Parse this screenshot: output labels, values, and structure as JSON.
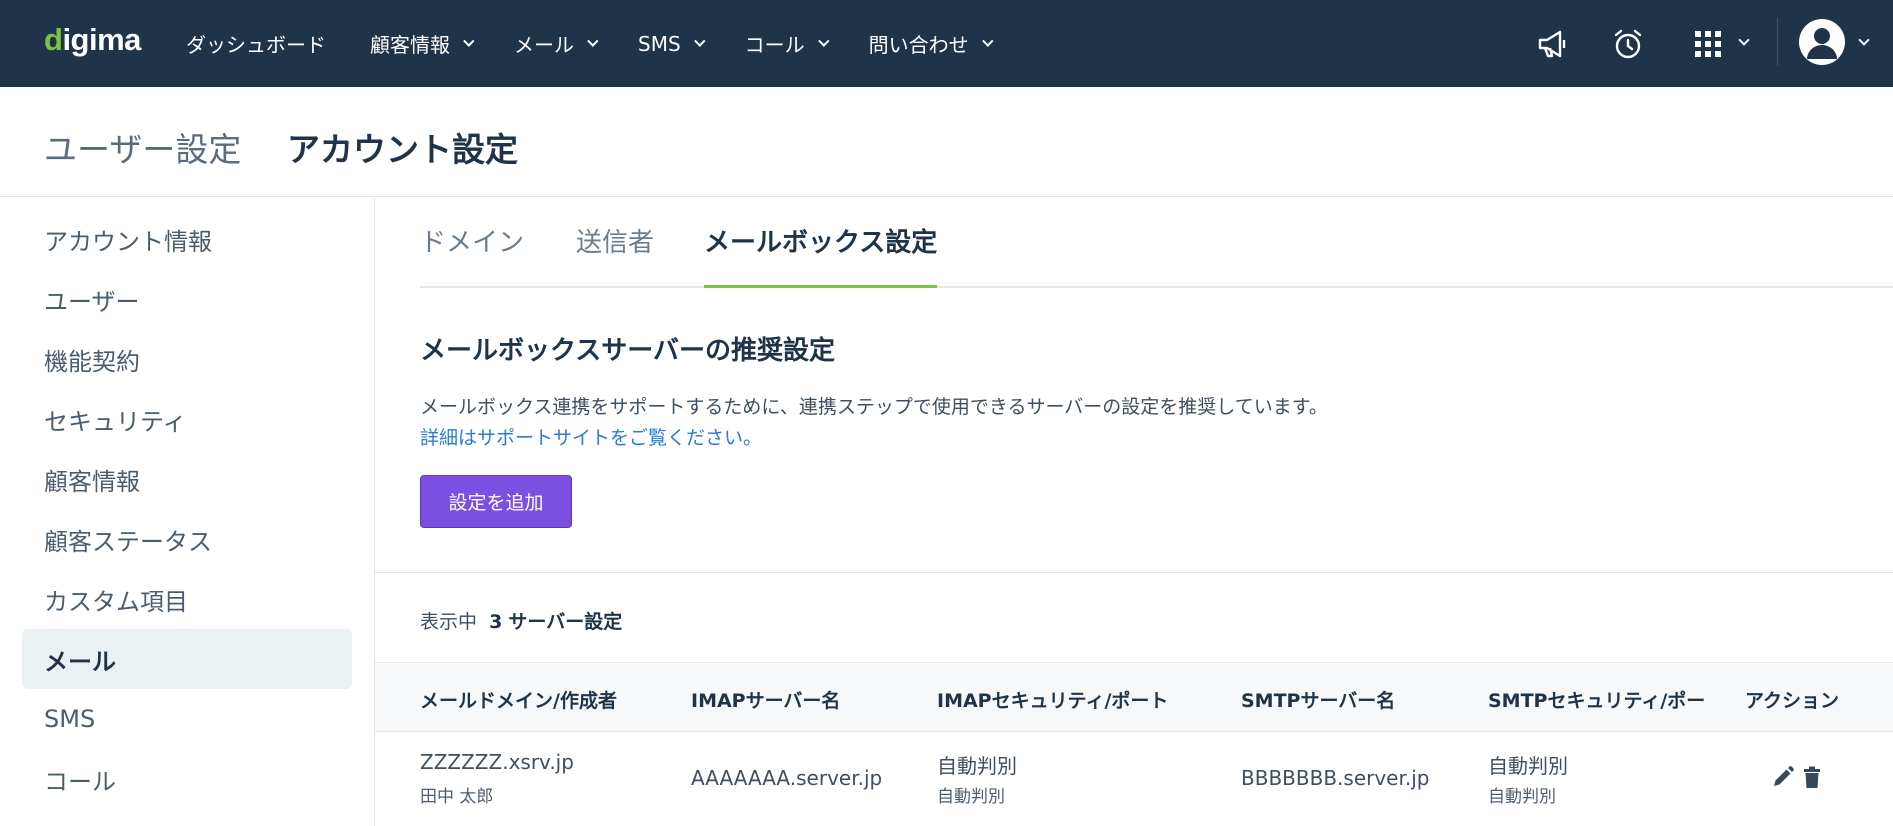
{
  "app": {
    "logo_pre": "d",
    "logo_rest": "igima"
  },
  "nav": {
    "items": [
      {
        "label": "ダッシュボード",
        "has_menu": false
      },
      {
        "label": "顧客情報",
        "has_menu": true
      },
      {
        "label": "メール",
        "has_menu": true
      },
      {
        "label": "SMS",
        "has_menu": true
      },
      {
        "label": "コール",
        "has_menu": true
      },
      {
        "label": "問い合わせ",
        "has_menu": true
      }
    ],
    "right_icons": [
      "megaphone-icon",
      "alarm-clock-icon",
      "apps-grid-icon",
      "user-avatar-icon"
    ]
  },
  "header": {
    "breadcrumb": "ユーザー設定",
    "title": "アカウント設定"
  },
  "sidebar": {
    "items": [
      {
        "label": "アカウント情報",
        "active": false
      },
      {
        "label": "ユーザー",
        "active": false
      },
      {
        "label": "機能契約",
        "active": false
      },
      {
        "label": "セキュリティ",
        "active": false
      },
      {
        "label": "顧客情報",
        "active": false
      },
      {
        "label": "顧客ステータス",
        "active": false
      },
      {
        "label": "カスタム項目",
        "active": false
      },
      {
        "label": "メール",
        "active": true
      },
      {
        "label": "SMS",
        "active": false
      },
      {
        "label": "コール",
        "active": false
      }
    ]
  },
  "tabs": [
    {
      "label": "ドメイン",
      "active": false
    },
    {
      "label": "送信者",
      "active": false
    },
    {
      "label": "メールボックス設定",
      "active": true
    }
  ],
  "section": {
    "title": "メールボックスサーバーの推奨設定",
    "description": "メールボックス連携をサポートするために、連携ステップで使用できるサーバーの設定を推奨しています。",
    "link": "詳細はサポートサイトをご覧ください。",
    "add_button": "設定を追加"
  },
  "count": {
    "prefix": "表示中",
    "value": "3",
    "suffix": "サーバー設定"
  },
  "table": {
    "columns": [
      "メールドメイン/作成者",
      "IMAPサーバー名",
      "IMAPセキュリティ/ポート",
      "SMTPサーバー名",
      "SMTPセキュリティ/ポー",
      "アクション"
    ],
    "rows": [
      {
        "domain": "ZZZZZZ.xsrv.jp",
        "creator": "田中 太郎",
        "imap_server": "AAAAAAA.server.jp",
        "imap_security": "自動判別",
        "imap_port": "自動判別",
        "smtp_server": "BBBBBBB.server.jp",
        "smtp_security": "自動判別",
        "smtp_port": "自動判別"
      }
    ]
  },
  "colors": {
    "nav_bg": "#1f3449",
    "brand_green": "#7dc242",
    "primary_button": "#7b4fe0",
    "link": "#2a7bd6",
    "active_side_bg": "#ebf1f3"
  }
}
